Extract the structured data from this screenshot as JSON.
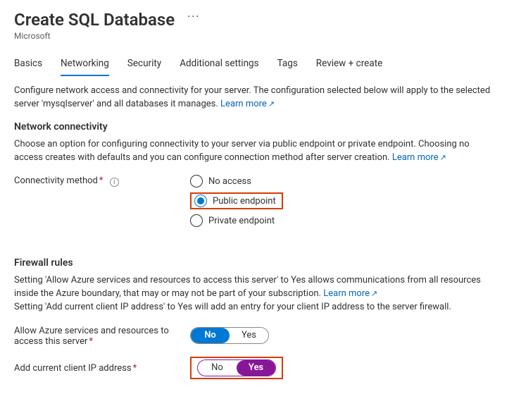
{
  "header": {
    "title": "Create SQL Database",
    "provider": "Microsoft"
  },
  "tabs": [
    {
      "id": "basics",
      "label": "Basics"
    },
    {
      "id": "networking",
      "label": "Networking"
    },
    {
      "id": "security",
      "label": "Security"
    },
    {
      "id": "additional",
      "label": "Additional settings"
    },
    {
      "id": "tags",
      "label": "Tags"
    },
    {
      "id": "review",
      "label": "Review + create"
    }
  ],
  "active_tab": "networking",
  "intro": {
    "text": "Configure network access and connectivity for your server. The configuration selected below will apply to the selected server 'mysqlserver' and all databases it manages.",
    "learn_more": "Learn more"
  },
  "connectivity": {
    "heading": "Network connectivity",
    "desc": "Choose an option for configuring connectivity to your server via public endpoint or private endpoint. Choosing no access creates with defaults and you can configure connection method after server creation.",
    "learn_more": "Learn more",
    "label": "Connectivity method",
    "options": [
      {
        "id": "noaccess",
        "label": "No access"
      },
      {
        "id": "public",
        "label": "Public endpoint"
      },
      {
        "id": "private",
        "label": "Private endpoint"
      }
    ],
    "selected": "public"
  },
  "firewall": {
    "heading": "Firewall rules",
    "desc1": "Setting 'Allow Azure services and resources to access this server' to Yes allows communications from all resources inside the Azure boundary, that may or may not be part of your subscription.",
    "learn_more": "Learn more",
    "desc2": "Setting 'Add current client IP address' to Yes will add an entry for your client IP address to the server firewall.",
    "allow_azure_label": "Allow Azure services and resources to access this server",
    "add_ip_label": "Add current client IP address",
    "no": "No",
    "yes": "Yes",
    "allow_azure_value": "No",
    "add_ip_value": "Yes"
  }
}
